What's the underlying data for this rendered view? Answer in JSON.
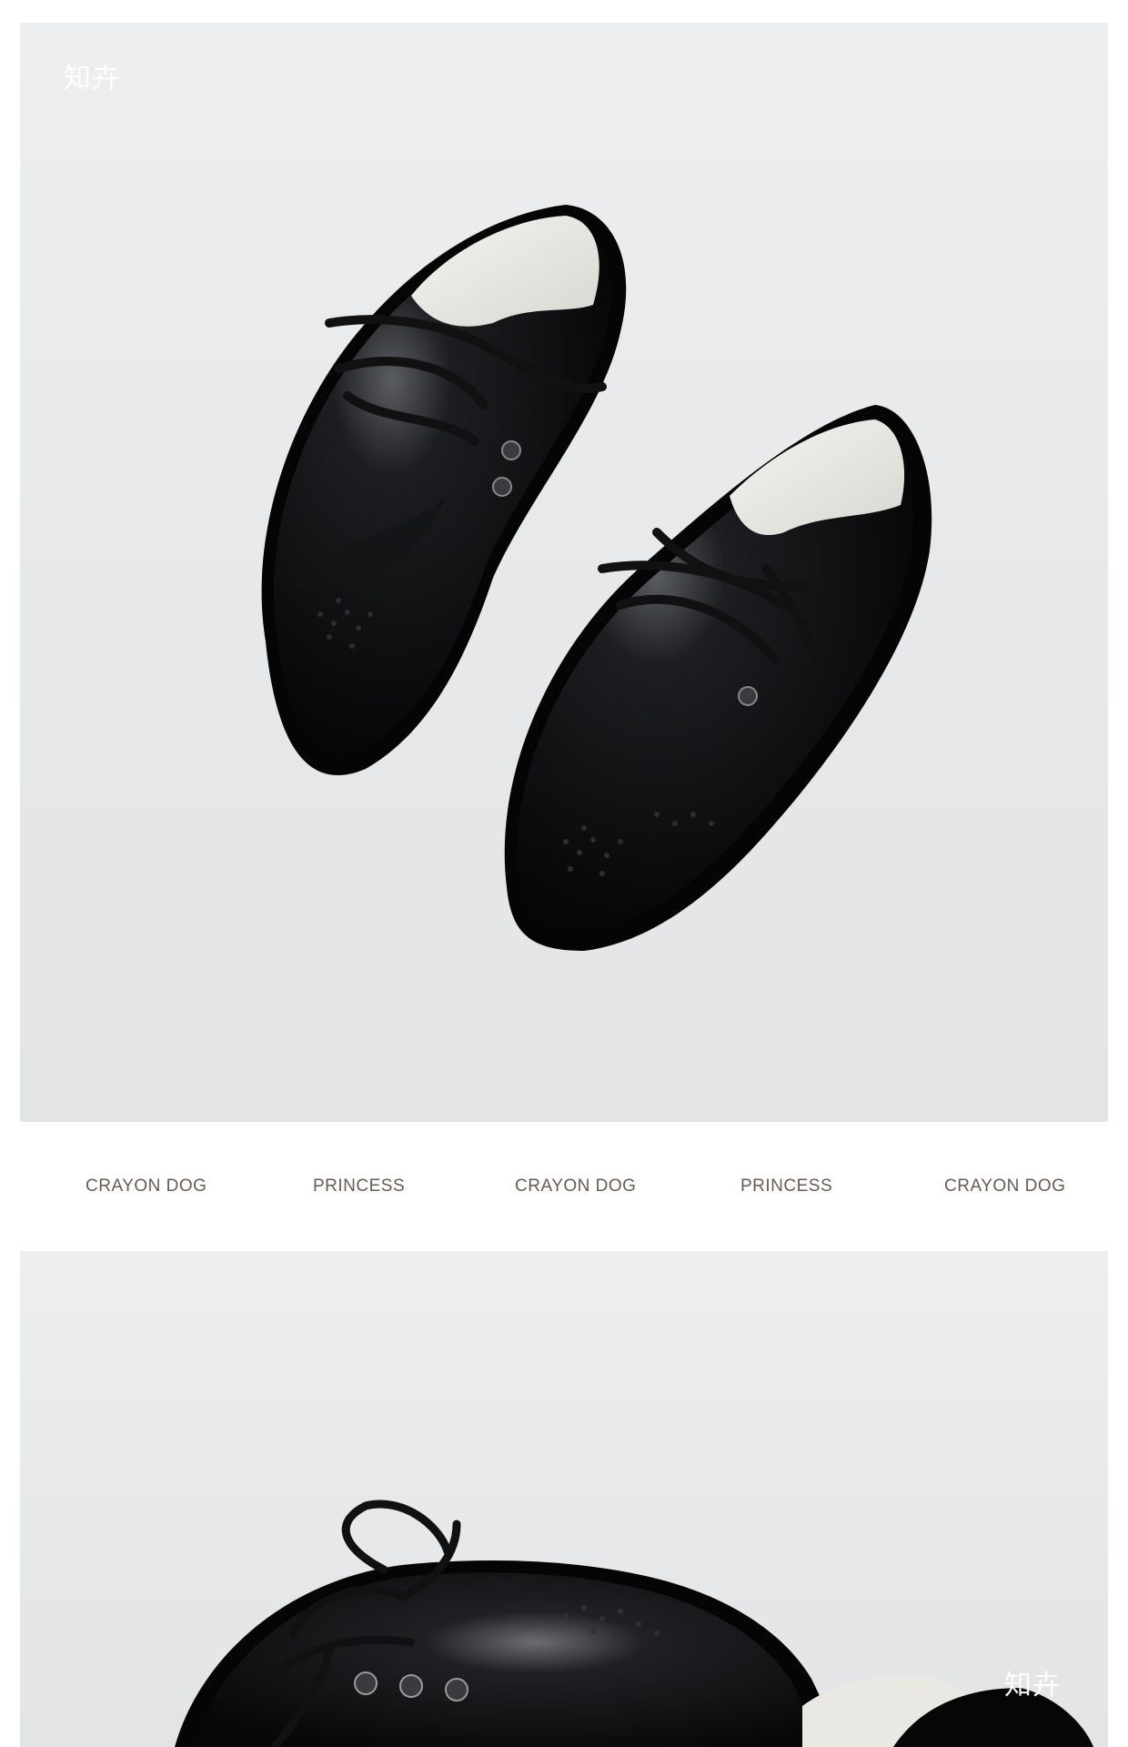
{
  "watermark_top": "知卉",
  "watermark_bottom": "知卉",
  "brand_strip": [
    "CRAYON DOG",
    "PRINCESS",
    "CRAYON DOG",
    "PRINCESS",
    "CRAYON DOG"
  ],
  "colors": {
    "background": "#ffffff",
    "photo_backdrop": "#e8eaec",
    "shoe_leather": "#0b0b0c",
    "brand_text": "#6a5a52"
  }
}
